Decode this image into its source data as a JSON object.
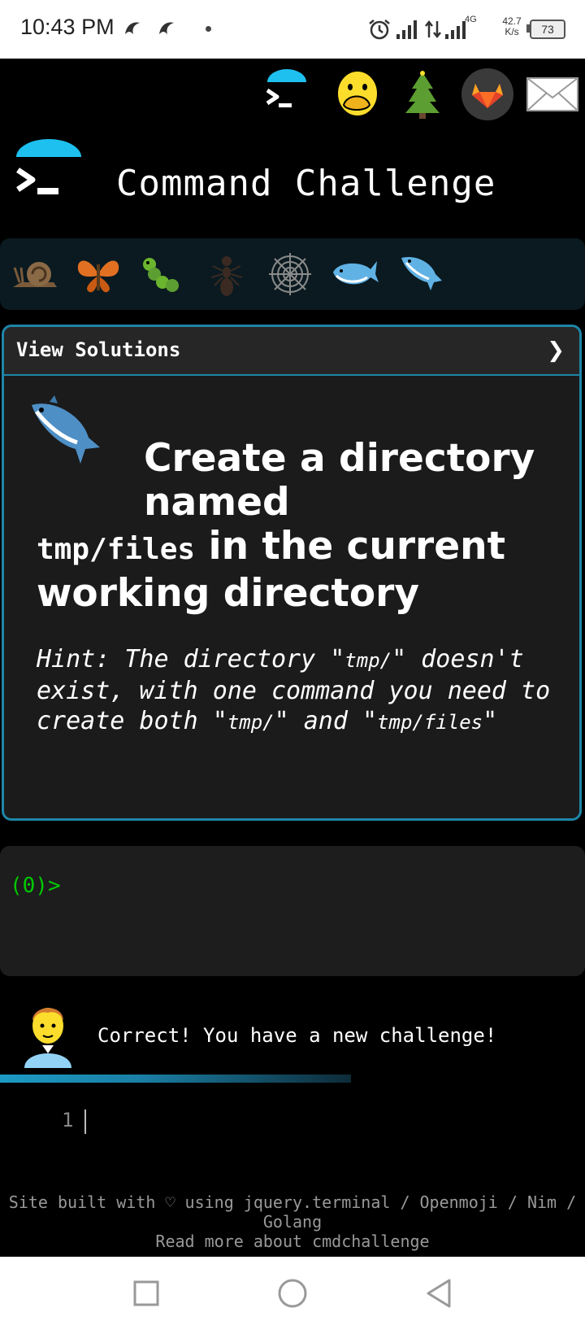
{
  "status_bar": {
    "time": "10:43 PM",
    "network_type": "4G",
    "net_speed_value": "42.7",
    "net_speed_unit": "K/s",
    "battery": "73",
    "icons": [
      "app-notification-icon",
      "app-notification-icon",
      "alarm-icon",
      "signal-icon",
      "data-arrows-icon",
      "signal-icon",
      "battery-icon"
    ]
  },
  "top_nav": {
    "icons": [
      "terminal-logo-icon",
      "face-with-hand-over-mouth-icon",
      "tree-icon",
      "gitlab-icon",
      "mail-icon"
    ]
  },
  "header": {
    "title": "Command Challenge"
  },
  "levels": {
    "icons": [
      "snail-icon",
      "butterfly-icon",
      "caterpillar-icon",
      "ant-icon",
      "spider-web-icon",
      "whale-icon",
      "dolphin-icon"
    ]
  },
  "challenge": {
    "solutions_label": "View Solutions",
    "solutions_chevron": "❯",
    "title_part1": "Create a directory named",
    "title_code": "tmp/files",
    "title_part2": "in the current working directory",
    "hint_part1": "Hint: The directory \"",
    "hint_code1": "tmp/",
    "hint_part2": "\" doesn't exist, with one command you need to create both \"",
    "hint_code2": "tmp/",
    "hint_part3": "\" and \"",
    "hint_code3": "tmp/files",
    "hint_part4": "\""
  },
  "terminal": {
    "prompt": "(0)>"
  },
  "feedback": {
    "message": "Correct! You have a new challenge!"
  },
  "progress": {
    "fraction": 0.6
  },
  "editor": {
    "line_number": "1"
  },
  "footer": {
    "line1": "Site built with ♡ using jquery.terminal / Openmoji / Nim / Golang",
    "line2": "Read more about cmdchallenge"
  },
  "colors": {
    "accent": "#1e86a8",
    "prompt_green": "#00c800",
    "card_bg": "#1b1b1b"
  }
}
